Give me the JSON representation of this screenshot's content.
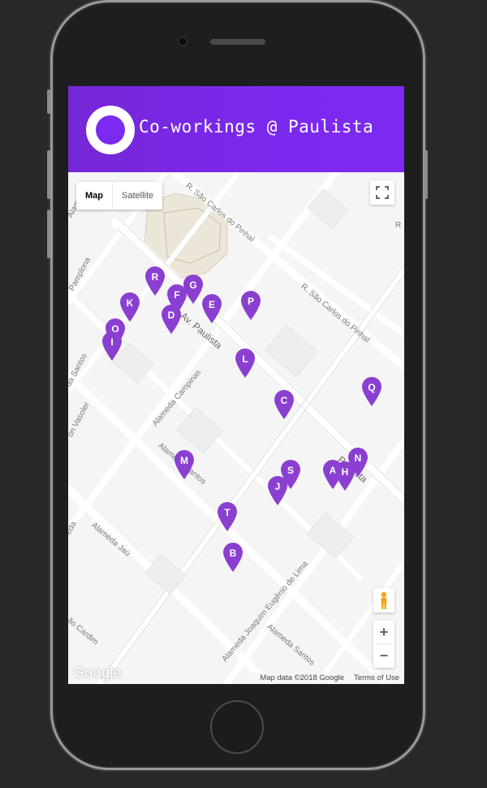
{
  "app": {
    "title": "Co-workings @ Paulista",
    "accent_color": "#7b2af0",
    "logo_icon": "circle-logo-icon"
  },
  "map": {
    "map_type": {
      "options": [
        "Map",
        "Satellite"
      ],
      "selected": "Map"
    },
    "streets": [
      {
        "id": "sao-carlos-1",
        "name": "R. São Carlos do Pinhal"
      },
      {
        "id": "sao-carlos-2",
        "name": "R. São Carlos do Pinhal"
      },
      {
        "id": "pamplona",
        "name": "Pamplona"
      },
      {
        "id": "paulista",
        "name": "Av. Paulista"
      },
      {
        "id": "paulista-2",
        "name": "Paulista"
      },
      {
        "id": "campinas",
        "name": "Alameda Campinas"
      },
      {
        "id": "santos-1",
        "name": "Alameda Santos"
      },
      {
        "id": "santos-2",
        "name": "Alameda Santos"
      },
      {
        "id": "jau",
        "name": "Alameda Jaú"
      },
      {
        "id": "joaquim",
        "name": "Alameda Joaquim Eugênio de Lima"
      },
      {
        "id": "cardim",
        "name": "ão Cardim"
      },
      {
        "id": "vasoler",
        "name": "on Vasoler"
      },
      {
        "id": "santos-left",
        "name": "da Santos"
      },
      {
        "id": "top-left",
        "name": "Alam"
      },
      {
        "id": "left-mid",
        "name": "eda"
      },
      {
        "id": "right-top",
        "name": "R"
      }
    ],
    "markers": [
      "R",
      "G",
      "F",
      "K",
      "E",
      "P",
      "D",
      "O",
      "I",
      "L",
      "C",
      "Q",
      "N",
      "A",
      "H",
      "S",
      "M",
      "J",
      "T",
      "B"
    ],
    "marker_color": "#8a3fd1",
    "controls": {
      "fullscreen_icon": "fullscreen-icon",
      "pegman_icon": "pegman-icon",
      "zoom_in": "+",
      "zoom_out": "−"
    },
    "logo_text": "Google",
    "attribution": {
      "data": "Map data ©2018 Google",
      "terms": "Terms of Use"
    }
  }
}
